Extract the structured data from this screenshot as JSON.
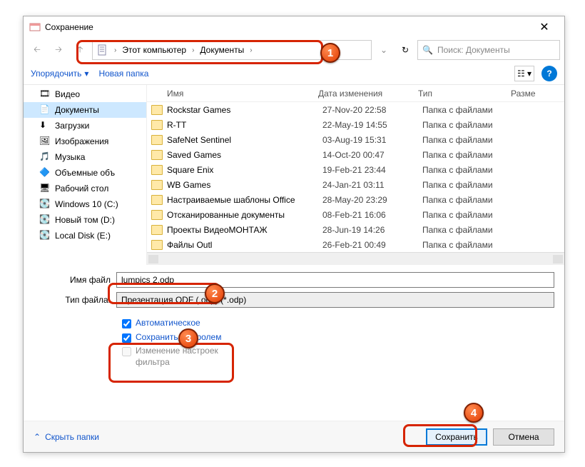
{
  "window": {
    "title": "Сохранение"
  },
  "breadcrumb": {
    "root": "Этот компьютер",
    "folder": "Документы"
  },
  "search": {
    "placeholder": "Поиск: Документы"
  },
  "toolbar": {
    "organize": "Упорядочить",
    "new_folder": "Новая папка"
  },
  "sidebar": {
    "items": [
      {
        "label": "Видео"
      },
      {
        "label": "Документы"
      },
      {
        "label": "Загрузки"
      },
      {
        "label": "Изображения"
      },
      {
        "label": "Музыка"
      },
      {
        "label": "Объемные объ"
      },
      {
        "label": "Рабочий стол"
      },
      {
        "label": "Windows 10 (C:)"
      },
      {
        "label": "Новый том (D:)"
      },
      {
        "label": "Local Disk (E:)"
      }
    ]
  },
  "columns": {
    "name": "Имя",
    "date": "Дата изменения",
    "type": "Тип",
    "size": "Разме"
  },
  "files": [
    {
      "name": "Rockstar Games",
      "date": "27-Nov-20 22:58",
      "type": "Папка с файлами"
    },
    {
      "name": "R-TT",
      "date": "22-May-19 14:55",
      "type": "Папка с файлами"
    },
    {
      "name": "SafeNet Sentinel",
      "date": "03-Aug-19 15:31",
      "type": "Папка с файлами"
    },
    {
      "name": "Saved Games",
      "date": "14-Oct-20 00:47",
      "type": "Папка с файлами"
    },
    {
      "name": "Square Enix",
      "date": "19-Feb-21 23:44",
      "type": "Папка с файлами"
    },
    {
      "name": "WB Games",
      "date": "24-Jan-21 03:11",
      "type": "Папка с файлами"
    },
    {
      "name": "Настраиваемые шаблоны Office",
      "date": "28-May-20 23:29",
      "type": "Папка с файлами"
    },
    {
      "name": "Отсканированные документы",
      "date": "08-Feb-21 16:06",
      "type": "Папка с файлами"
    },
    {
      "name": "Проекты ВидеоМОНТАЖ",
      "date": "28-Jun-19 14:26",
      "type": "Папка с файлами"
    },
    {
      "name": "Файлы Outl",
      "date": "26-Feb-21 00:49",
      "type": "Папка с файлами"
    }
  ],
  "inputs": {
    "filename_label": "Имя файл",
    "filename_value": "lumpics 2.odp",
    "filetype_label": "Тип файла:",
    "filetype_value": "Презентация ODF (.odp) (*.odp)"
  },
  "options": {
    "auto_ext": "Автоматическое",
    "save_pwd": "Сохранить с паролем",
    "filter": "Изменение настроек фильтра"
  },
  "footer": {
    "hide": "Скрыть папки",
    "save": "Сохранить",
    "cancel": "Отмена"
  }
}
